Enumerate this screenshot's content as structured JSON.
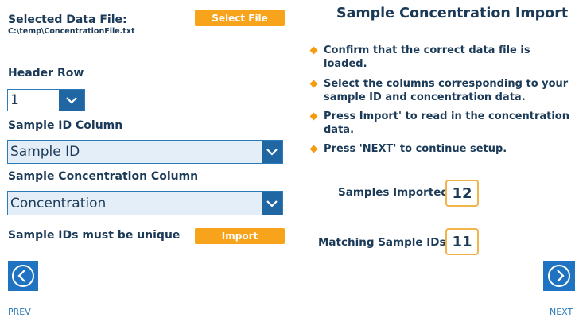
{
  "left": {
    "selected_file_label": "Selected Data File:",
    "selected_file_path": "C:\\temp\\ConcentrationFile.txt",
    "select_file_button": "Select File",
    "header_row_label": "Header Row",
    "header_row_value": "1",
    "sample_id_column_label": "Sample ID Column",
    "sample_id_column_value": "Sample ID",
    "sample_conc_column_label": "Sample Concentration Column",
    "sample_conc_column_value": "Concentration",
    "unique_note": "Sample IDs must be unique",
    "import_button": "Import"
  },
  "right": {
    "title": "Sample Concentration Import",
    "instructions": [
      "Confirm that the correct data file is loaded.",
      "Select the columns corresponding to your sample ID and concentration data.",
      "Press Import' to read in the concentration data.",
      "Press 'NEXT' to continue setup."
    ],
    "samples_imported_label": "Samples Imported:",
    "samples_imported_value": "12",
    "matching_ids_label": "Matching Sample IDs:",
    "matching_ids_value": "11"
  },
  "nav": {
    "prev_label": "PREV",
    "next_label": "NEXT"
  },
  "colors": {
    "accent_orange": "#f8a31c",
    "primary_blue": "#1f66a3",
    "text_navy": "#1b3a57"
  },
  "icons": {
    "dropdown": "chevron-down-icon",
    "prev": "chevron-left-circle-icon",
    "next": "chevron-right-circle-icon",
    "bullet": "diamond-bullet-icon"
  }
}
